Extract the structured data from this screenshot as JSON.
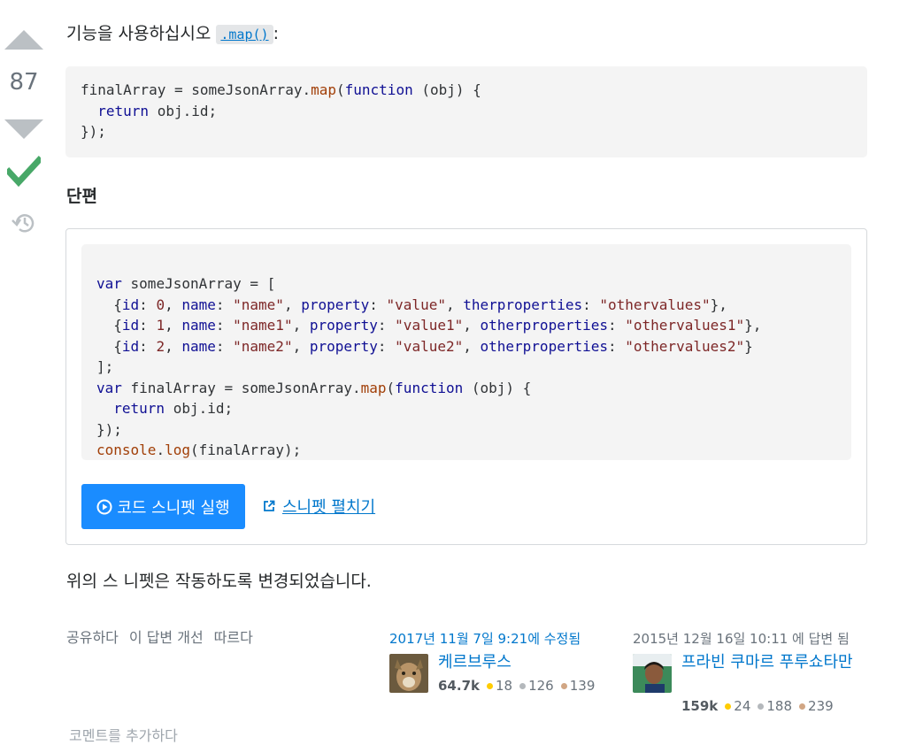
{
  "vote": {
    "count": "87"
  },
  "answer": {
    "intro_text": "기능을 사용하십시오",
    "inline_code": ".map()",
    "intro_suffix": ":",
    "code_lines": [
      "finalArray = someJsonArray.map(function (obj) {",
      "  return obj.id;",
      "});"
    ],
    "section_title": "단편",
    "note": "위의 스 니펫은 작동하도록 변경되었습니다."
  },
  "snippet": {
    "code_lines": [
      "var someJsonArray = [",
      "  {id: 0, name: \"name\", property: \"value\", therproperties: \"othervalues\"},",
      "  {id: 1, name: \"name1\", property: \"value1\", otherproperties: \"othervalues1\"},",
      "  {id: 2, name: \"name2\", property: \"value2\", otherproperties: \"othervalues2\"}",
      "];",
      "var finalArray = someJsonArray.map(function (obj) {",
      "  return obj.id;",
      "});",
      "console.log(finalArray);"
    ],
    "run_label": "코드 스니펫 실행",
    "expand_label": "스니펫 펼치기"
  },
  "post_menu": {
    "share": "공유하다",
    "improve": "이 답변 개선",
    "follow": "따르다"
  },
  "edited": {
    "time": "2017년 11월 7일 9:21에 수정됨",
    "user": "케르브루스",
    "reputation": "64.7k",
    "gold": "18",
    "silver": "126",
    "bronze": "139"
  },
  "answered": {
    "time": "2015년 12월 16일 10:11 에 답변 됨",
    "user": "프라빈 쿠마르 푸루쇼타만",
    "reputation": "159k",
    "gold": "24",
    "silver": "188",
    "bronze": "239"
  },
  "comments": {
    "add_label": "코멘트를 추가하다"
  },
  "colors": {
    "accent": "#0077cc",
    "run_button": "#1a8cff",
    "accepted": "#48a868",
    "vote_arrow": "#bbc0c4"
  },
  "icons": [
    "vote-up-icon",
    "vote-down-icon",
    "accepted-check-icon",
    "history-icon",
    "play-icon",
    "external-link-icon"
  ]
}
